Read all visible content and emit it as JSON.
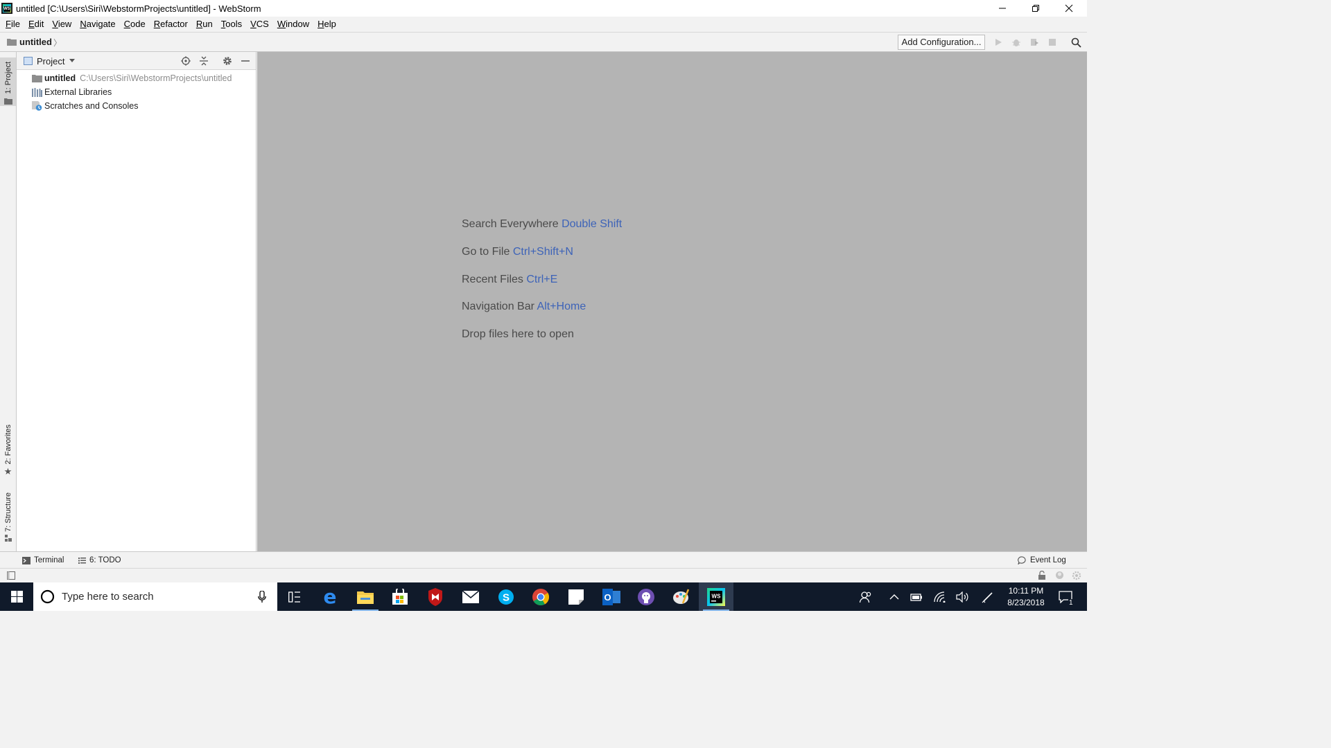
{
  "window": {
    "title": "untitled [C:\\Users\\Siri\\WebstormProjects\\untitled] - WebStorm",
    "min_glyph": "—",
    "close_glyph": "✕"
  },
  "menu": [
    "File",
    "Edit",
    "View",
    "Navigate",
    "Code",
    "Refactor",
    "Run",
    "Tools",
    "VCS",
    "Window",
    "Help"
  ],
  "navbar": {
    "project": "untitled",
    "chevron": "〉",
    "add_config_label": "Add Configuration..."
  },
  "stripe": {
    "project": "1: Project",
    "favorites": "2: Favorites",
    "structure": "7: Structure"
  },
  "project_panel": {
    "title": "Project",
    "tree": {
      "root_name": "untitled",
      "root_path": "C:\\Users\\Siri\\WebstormProjects\\untitled",
      "external_libraries": "External Libraries",
      "scratches": "Scratches and Consoles"
    }
  },
  "editor": {
    "hints": [
      {
        "label": "Search Everywhere",
        "shortcut": "Double Shift"
      },
      {
        "label": "Go to File",
        "shortcut": "Ctrl+Shift+N"
      },
      {
        "label": "Recent Files",
        "shortcut": "Ctrl+E"
      },
      {
        "label": "Navigation Bar",
        "shortcut": "Alt+Home"
      },
      {
        "label": "Drop files here to open",
        "shortcut": ""
      }
    ]
  },
  "bottom": {
    "terminal": "Terminal",
    "todo": "6: TODO",
    "event_log": "Event Log"
  },
  "taskbar": {
    "search_placeholder": "Type here to search",
    "time": "10:11 PM",
    "date": "8/23/2018",
    "notifications": "1"
  },
  "colors": {
    "editor_bg": "#b4b4b4",
    "shortcut_blue": "#3d63b8",
    "taskbar": "#101a2a"
  }
}
